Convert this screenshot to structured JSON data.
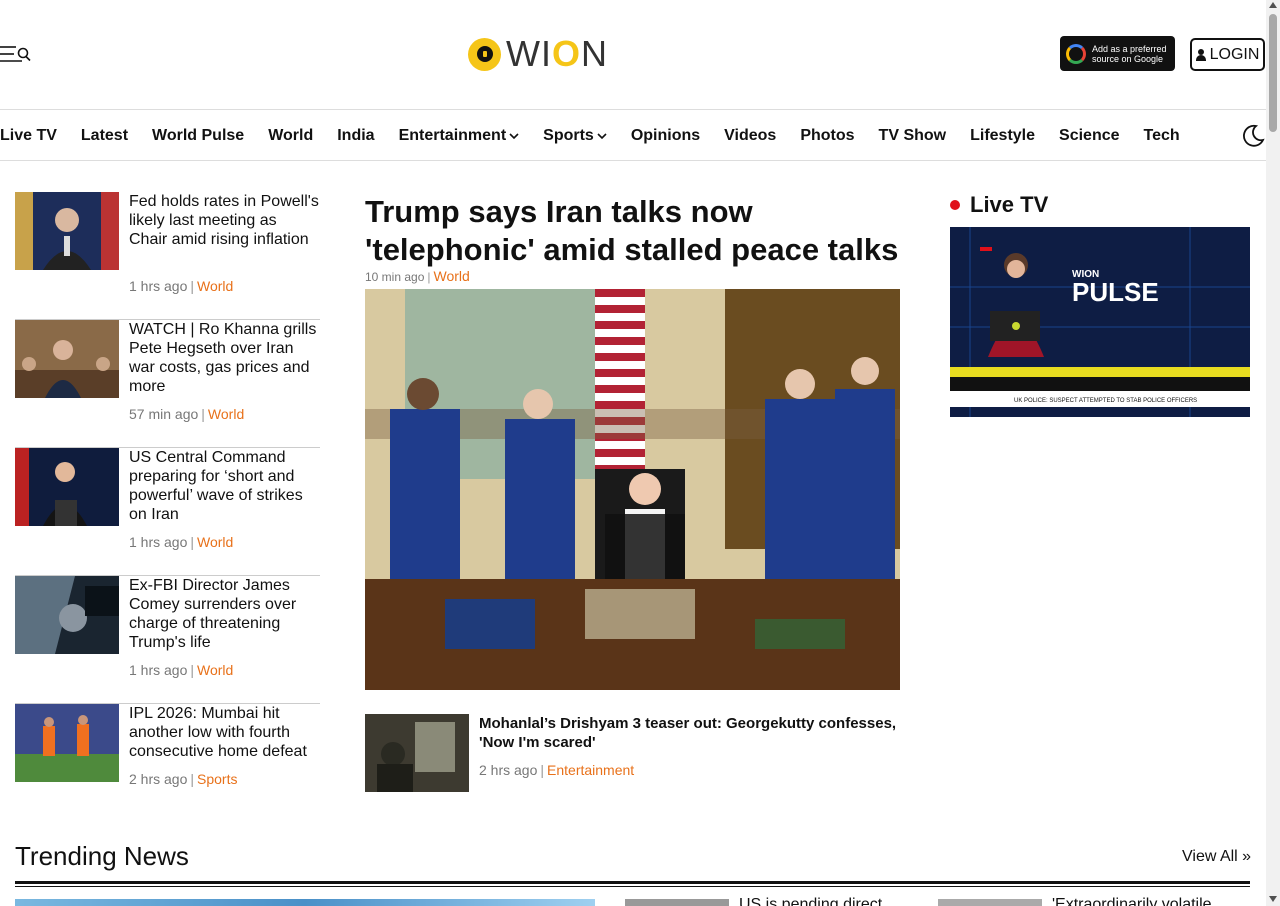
{
  "header": {
    "logo_text_w": "W",
    "logo_text_i": "I",
    "logo_text_o": "O",
    "logo_text_n": "N",
    "google_line1": "Add as a preferred",
    "google_line2": "source on Google",
    "login_label": "LOGIN"
  },
  "nav": {
    "items": [
      "Live TV",
      "Latest",
      "World Pulse",
      "World",
      "India",
      "Entertainment",
      "Sports",
      "Opinions",
      "Videos",
      "Photos",
      "TV Show",
      "Lifestyle",
      "Science",
      "Tech"
    ]
  },
  "left_stories": [
    {
      "title": "Fed holds rates in Powell's likely last meeting as Chair amid rising inflation",
      "time": "1 hrs ago",
      "category": "World"
    },
    {
      "title": "WATCH | Ro Khanna grills Pete Hegseth over Iran war costs, gas prices and more",
      "time": "57 min ago",
      "category": "World"
    },
    {
      "title": "US Central Command preparing for ‘short and powerful’ wave of strikes on Iran",
      "time": "1 hrs ago",
      "category": "World"
    },
    {
      "title": "Ex-FBI Director James Comey surrenders over charge of threatening Trump's life",
      "time": "1 hrs ago",
      "category": "World"
    },
    {
      "title": "IPL 2026: Mumbai hit another low with fourth consecutive home defeat",
      "time": "2 hrs ago",
      "category": "Sports"
    }
  ],
  "main_story": {
    "title": "Trump says Iran talks now 'telephonic' amid stalled peace talks",
    "time": "10 min ago",
    "category": "World"
  },
  "sub_story": {
    "title": "Mohanlal’s Drishyam 3 teaser out: Georgekutty confesses, 'Now I'm scared'",
    "time": "2 hrs ago",
    "category": "Entertainment"
  },
  "live_tv": {
    "label": "Live TV",
    "brand_small": "WION",
    "brand_big": "PULSE",
    "ticker": "UK POLICE: SUSPECT ATTEMPTED TO STAB POLICE OFFICERS"
  },
  "trending": {
    "heading": "Trending News",
    "view_all": "View All »",
    "item2_title": "US is pending direct",
    "item3_title": "'Extraordinarily volatile"
  },
  "colors": {
    "accent": "#e8711a",
    "live_dot": "#e0101a",
    "logo_yellow": "#f5c518"
  }
}
